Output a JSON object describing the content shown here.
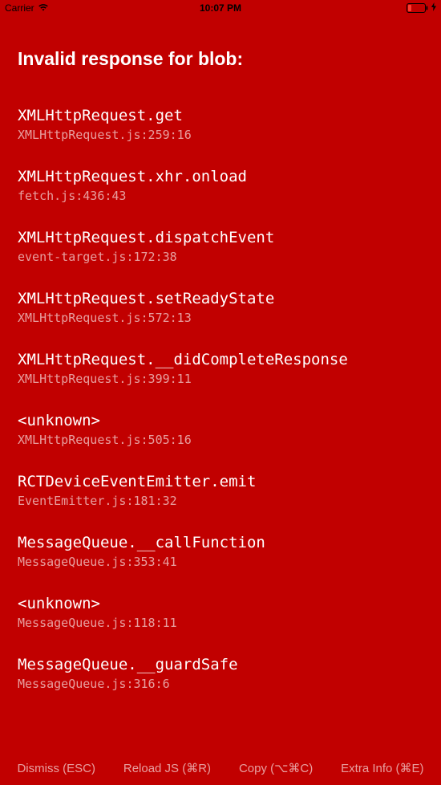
{
  "statusBar": {
    "carrier": "Carrier",
    "time": "10:07 PM"
  },
  "errorTitle": "Invalid response for blob:",
  "stackFrames": [
    {
      "func": "XMLHttpRequest.get",
      "loc": "XMLHttpRequest.js:259:16"
    },
    {
      "func": "XMLHttpRequest.xhr.onload",
      "loc": "fetch.js:436:43"
    },
    {
      "func": "XMLHttpRequest.dispatchEvent",
      "loc": "event-target.js:172:38"
    },
    {
      "func": "XMLHttpRequest.setReadyState",
      "loc": "XMLHttpRequest.js:572:13"
    },
    {
      "func": "XMLHttpRequest.__didCompleteResponse",
      "loc": "XMLHttpRequest.js:399:11"
    },
    {
      "func": "<unknown>",
      "loc": "XMLHttpRequest.js:505:16"
    },
    {
      "func": "RCTDeviceEventEmitter.emit",
      "loc": "EventEmitter.js:181:32"
    },
    {
      "func": "MessageQueue.__callFunction",
      "loc": "MessageQueue.js:353:41"
    },
    {
      "func": "<unknown>",
      "loc": "MessageQueue.js:118:11"
    },
    {
      "func": "MessageQueue.__guardSafe",
      "loc": "MessageQueue.js:316:6"
    }
  ],
  "bottomBar": {
    "dismiss": "Dismiss (ESC)",
    "reload": "Reload JS (⌘R)",
    "copy": "Copy (⌥⌘C)",
    "extra": "Extra Info (⌘E)"
  }
}
